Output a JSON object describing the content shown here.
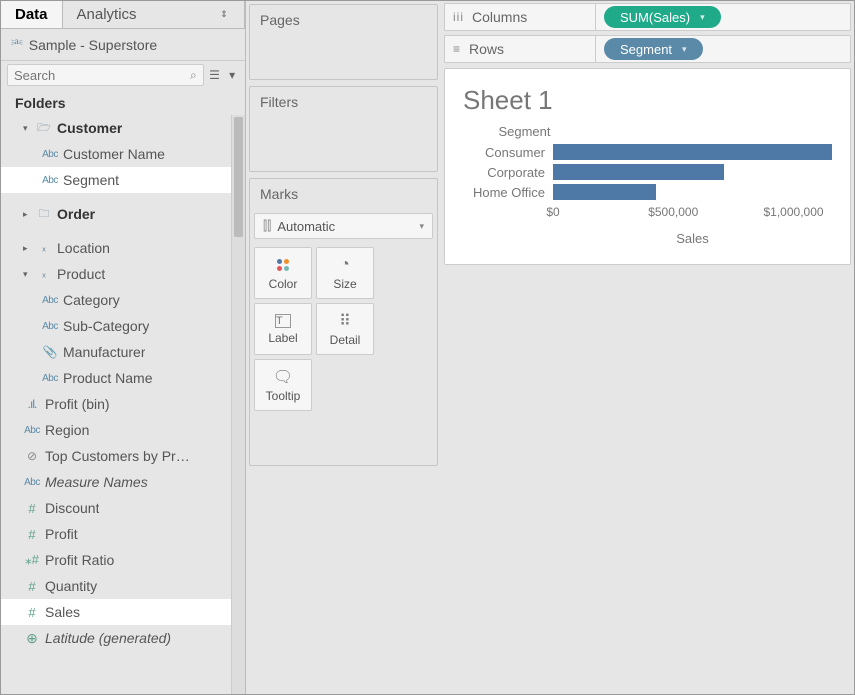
{
  "tabs": {
    "data": "Data",
    "analytics": "Analytics"
  },
  "datasource": "Sample - Superstore",
  "search": {
    "placeholder": "Search"
  },
  "folders_label": "Folders",
  "tree": {
    "customer": {
      "label": "Customer",
      "name": "Customer Name",
      "segment": "Segment"
    },
    "order": "Order",
    "location": "Location",
    "product": {
      "label": "Product",
      "category": "Category",
      "subcat": "Sub-Category",
      "manufacturer": "Manufacturer",
      "pname": "Product Name"
    },
    "profit_bin": "Profit (bin)",
    "region": "Region",
    "top_customers": "Top Customers by Pr…",
    "measure_names": "Measure Names",
    "discount": "Discount",
    "profit": "Profit",
    "profit_ratio": "Profit Ratio",
    "quantity": "Quantity",
    "sales": "Sales",
    "latitude": "Latitude (generated)"
  },
  "shelves": {
    "pages": "Pages",
    "filters": "Filters",
    "marks": "Marks"
  },
  "marks": {
    "select": "Automatic",
    "color": "Color",
    "size": "Size",
    "label": "Label",
    "detail": "Detail",
    "tooltip": "Tooltip"
  },
  "cols": {
    "label": "Columns",
    "pill": "SUM(Sales)"
  },
  "rows": {
    "label": "Rows",
    "pill": "Segment"
  },
  "viz": {
    "title": "Sheet 1",
    "dim_header": "Segment",
    "axis_label": "Sales"
  },
  "ticks": [
    "$0",
    "$500,000",
    "$1,000,000"
  ],
  "chart_data": {
    "type": "bar",
    "categories": [
      "Consumer",
      "Corporate",
      "Home Office"
    ],
    "values": [
      1160000,
      710000,
      430000
    ],
    "title": "Sheet 1",
    "xlabel": "Sales",
    "ylabel": "Segment",
    "xlim": [
      0,
      1160000
    ],
    "tick_values": [
      0,
      500000,
      1000000
    ]
  }
}
